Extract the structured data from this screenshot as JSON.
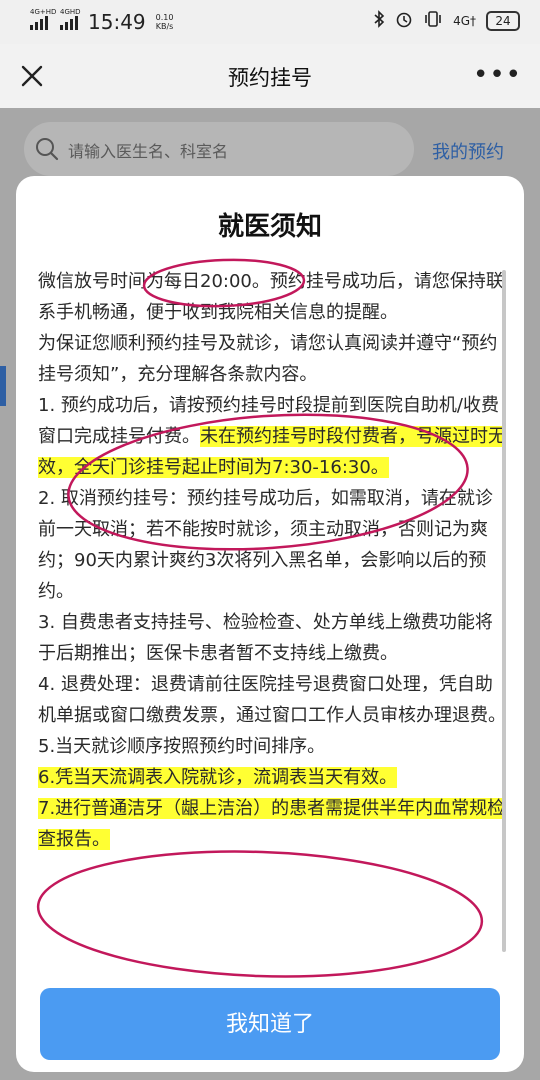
{
  "status_bar": {
    "signal_1": "4G+HD",
    "signal_2": "4GHD",
    "time": "15:49",
    "speed_value": "0.10",
    "speed_unit": "KB/s",
    "network": "4G†",
    "battery": "24"
  },
  "nav": {
    "title": "预约挂号",
    "more": "•••"
  },
  "search": {
    "placeholder": "请输入医生名、科室名",
    "my_appointments": "我的预约"
  },
  "modal": {
    "title": "就医须知",
    "paragraphs": [
      [
        "微信放号时间为每日20:00。预约挂号成功后，请您保持联系手机畅通，便于收到我院相关信息的提醒。"
      ],
      [
        "为保证您顺利预约挂号及就诊，请您认真阅读并遵守“预约挂号须知”，充分理解各条款内容。"
      ],
      [
        "1. 预约成功后，请按预约挂号时段提前到医院自助机/收费窗口完成挂号付费。",
        "未在预约挂号时段付费者，号源过时无效，全天门诊挂号起止时间为7:30-16:30。"
      ],
      [
        "2. 取消预约挂号：预约挂号成功后，如需取消，请在就诊前一天取消；若不能按时就诊，须主动取消，否则记为爽约；90天内累计爽约3次将列入黑名单，会影响以后的预约。"
      ],
      [
        "3. 自费患者支持挂号、检验检查、处方单线上缴费功能将于后期推出；医保卡患者暂不支持线上缴费。"
      ],
      [
        "4. 退费处理：退费请前往医院挂号退费窗口处理，凭自助机单据或窗口缴费发票，通过窗口工作人员审核办理退费。"
      ],
      [
        "5.当天就诊顺序按照预约时间排序。"
      ],
      [
        "",
        "6.凭当天流调表入院就诊，流调表当天有效。"
      ],
      [
        "",
        "7.进行普通洁牙（龈上洁治）的患者需提供半年内血常规检查报告。"
      ]
    ],
    "confirm_button": "我知道了"
  },
  "colors": {
    "accent": "#4b9bf2",
    "link": "#2e5fa4",
    "highlight": "#ffff33",
    "annotation": "#c2185b"
  }
}
